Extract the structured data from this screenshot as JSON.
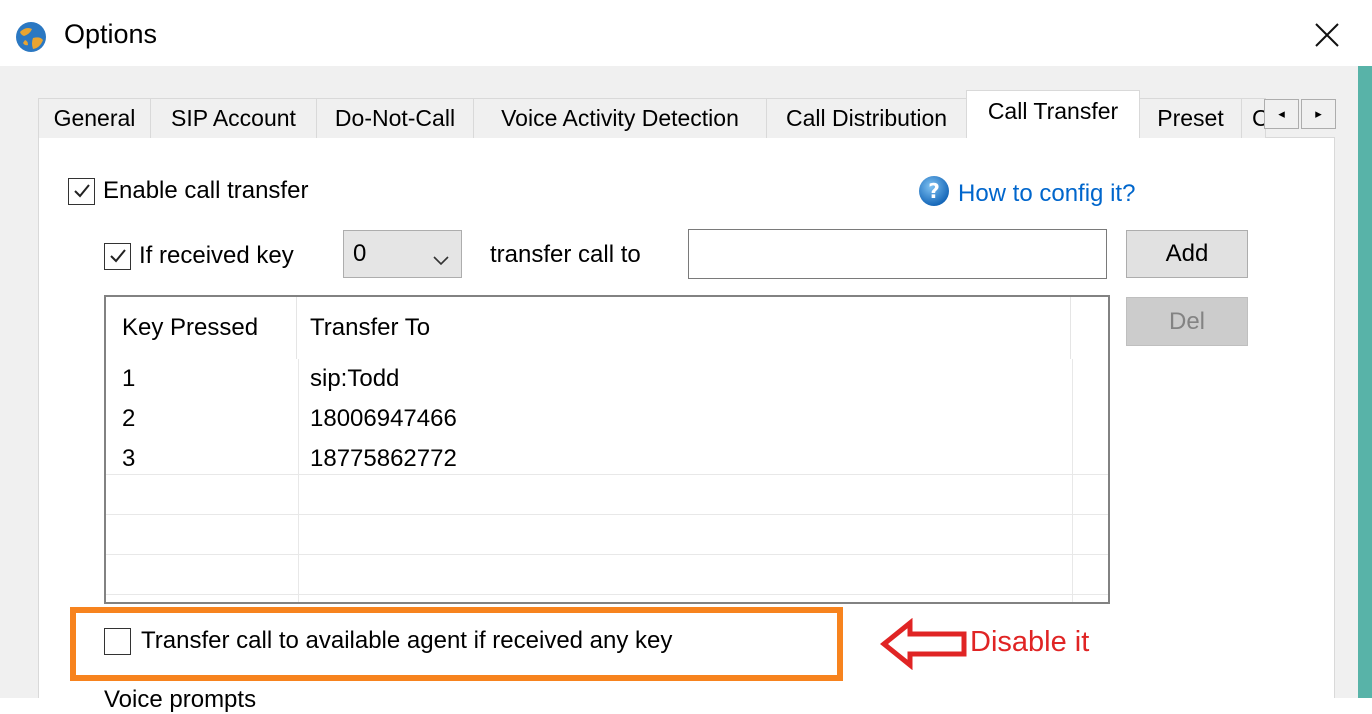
{
  "window": {
    "title": "Options",
    "app_icon": "globe-icon",
    "close_glyph": "close-icon"
  },
  "tabs": [
    {
      "label": "General",
      "active": false
    },
    {
      "label": "SIP Account",
      "active": false
    },
    {
      "label": "Do-Not-Call",
      "active": false
    },
    {
      "label": "Voice Activity Detection",
      "active": false
    },
    {
      "label": "Call Distribution",
      "active": false
    },
    {
      "label": "Call Transfer",
      "active": true
    },
    {
      "label": "Preset",
      "active": false
    },
    {
      "label": "C",
      "active": false
    }
  ],
  "tab_scroll": {
    "left": "◂",
    "right": "▸"
  },
  "call_transfer": {
    "enable_label": "Enable call transfer",
    "enable_checked": true,
    "help_label": "How to config it?",
    "help_icon": "help-icon",
    "if_key_label": "If received key",
    "if_key_checked": true,
    "key_selected": "0",
    "transfer_to_label": "transfer call to",
    "transfer_to_value": "",
    "add_label": "Add",
    "del_label": "Del",
    "columns": [
      "Key Pressed",
      "Transfer To"
    ],
    "rows": [
      {
        "key": "1",
        "to": "sip:Todd"
      },
      {
        "key": "2",
        "to": "18006947466"
      },
      {
        "key": "3",
        "to": "18775862772"
      }
    ],
    "any_key_label": "Transfer call to available agent if received any key",
    "any_key_checked": false,
    "partial_label": "Voice prompts"
  },
  "annotation": {
    "text": "Disable it",
    "arrow_icon": "arrow-left-icon",
    "highlight_color": "#f7831e",
    "text_color": "#e02424"
  },
  "colors": {
    "link": "#0066cc",
    "dialog_bg": "#f0f0f0",
    "accent_strip": "#58b3a8"
  }
}
